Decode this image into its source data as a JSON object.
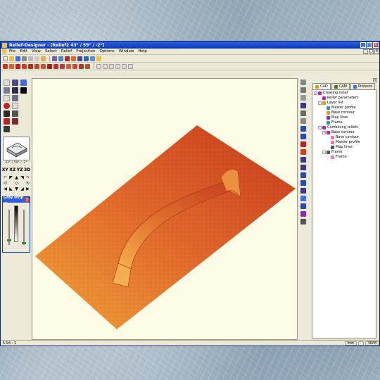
{
  "window": {
    "title": "Relief-Designer - [Relief2   43° / 59° / -2°]",
    "controls": [
      "_",
      "□",
      "×"
    ]
  },
  "menu": {
    "items": [
      "File",
      "Edit",
      "View",
      "Select",
      "Relief",
      "Projection",
      "Options",
      "Window",
      "Help"
    ]
  },
  "left_panel": {
    "angle_text": "43° / 59° / -2°",
    "view_buttons": [
      "XY",
      "XZ",
      "YZ",
      "3D"
    ],
    "grey_panel_title": "Grey strip ..."
  },
  "tabs": [
    {
      "label": "CAD",
      "active": true,
      "color": "#d4a017"
    },
    {
      "label": "CAM",
      "active": false,
      "color": "#2a8a2a"
    },
    {
      "label": "Protocol",
      "active": false,
      "color": "#3a6df0"
    }
  ],
  "tree": [
    {
      "label": "Creating relief",
      "depth": 0,
      "toggle": "-",
      "icon_color": "#c020c0"
    },
    {
      "label": "Relief parameters",
      "depth": 1,
      "toggle": "",
      "icon_color": "#c020c0"
    },
    {
      "label": "Layer list",
      "depth": 1,
      "toggle": "-",
      "icon_color": "#d4a017"
    },
    {
      "label": "Master profile",
      "depth": 2,
      "toggle": "",
      "icon_color": "#3a8ad0"
    },
    {
      "label": "Base contour",
      "depth": 2,
      "toggle": "",
      "icon_color": "#e09a20"
    },
    {
      "label": "Map lines",
      "depth": 2,
      "toggle": "",
      "icon_color": "#8a2ab0"
    },
    {
      "label": "Frame",
      "depth": 2,
      "toggle": "",
      "icon_color": "#20a0a0"
    },
    {
      "label": "Combining reliefs",
      "depth": 1,
      "toggle": "-",
      "icon_color": "#c020c0"
    },
    {
      "label": "Base contour",
      "depth": 2,
      "toggle": "-",
      "icon_color": "#c020c0"
    },
    {
      "label": "Base contour",
      "depth": 3,
      "toggle": "",
      "icon_color": "#e080a0"
    },
    {
      "label": "Master profile",
      "depth": 3,
      "toggle": "",
      "icon_color": "#e080a0"
    },
    {
      "label": "Map lines",
      "depth": 3,
      "toggle": "",
      "icon_color": "#555555"
    },
    {
      "label": "Frame",
      "depth": 2,
      "toggle": "-",
      "icon_color": "#555555"
    },
    {
      "label": "Frame",
      "depth": 3,
      "toggle": "",
      "icon_color": "#e080c0"
    }
  ],
  "status": {
    "left": "5.94 : 1",
    "unit": "mm",
    "num": "NUM"
  },
  "colors": {
    "relief_light": "#f0a43a",
    "relief_mid": "#e0662a",
    "relief_dark": "#c53a1c",
    "viewport_bg": "#fcfbe5"
  }
}
